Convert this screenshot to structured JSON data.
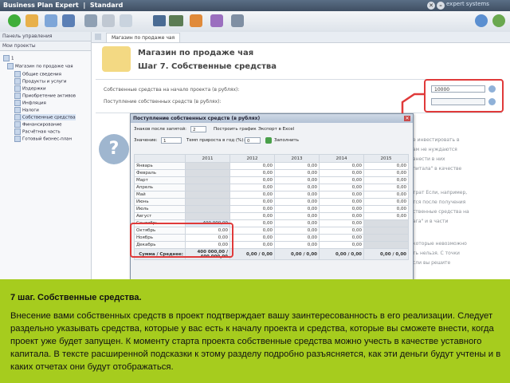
{
  "app": {
    "title": "Business Plan Expert",
    "edition": "Standard",
    "search_label": "expert systems"
  },
  "sidebar": {
    "panel_title": "Панель управления",
    "projects_title": "Мои проекты",
    "project_number": "1",
    "project_name": "Магазин по продаже чая",
    "items": [
      {
        "label": "Общие сведения"
      },
      {
        "label": "Продукты и услуги"
      },
      {
        "label": "Издержки"
      },
      {
        "label": "Приобретение активов"
      },
      {
        "label": "Инфляция"
      },
      {
        "label": "Налоги"
      },
      {
        "label": "Собственные средства"
      },
      {
        "label": "Финансирование"
      },
      {
        "label": "Расчётная часть"
      },
      {
        "label": "Готовый бизнес-план"
      }
    ]
  },
  "main": {
    "tab_label": "Магазин по продаже чая",
    "project_title": "Магазин по продаже чая",
    "step_title": "Шаг 7. Собственные средства",
    "field1_label": "Собственные средства на начало проекта (в рублях):",
    "field1_value": "10000",
    "field2_label": "Поступление собственных средств (в рублях):",
    "field2_value": "",
    "help_lines": [
      "е инвестировать в",
      "ам не нуждаются",
      "внести в них",
      "питала\" в качестве",
      "",
      "трат Если, например,",
      "тся после получения",
      "ственные средства на",
      "ага\" и в части",
      "",
      "которые невозможно",
      "ть нельзя. С точки",
      "сли вы решите"
    ]
  },
  "dialog": {
    "title": "Поступление собственных средств (в рублях)",
    "decimals_label": "Знаков после запятой:",
    "decimals_value": "2",
    "chart_button": "Построить график",
    "export_button": "Экспорт в Excel",
    "value_label": "Значение:",
    "value_input": "1",
    "growth_label": "Темп прироста в год (%):",
    "growth_input": "0",
    "fill_button": "Заполнить",
    "years": [
      "2011",
      "2012",
      "2013",
      "2014",
      "2015"
    ],
    "rows": [
      {
        "month": "Январь",
        "cells": [
          "",
          "0,00",
          "0,00",
          "0,00",
          "0,00"
        ]
      },
      {
        "month": "Февраль",
        "cells": [
          "",
          "0,00",
          "0,00",
          "0,00",
          "0,00"
        ]
      },
      {
        "month": "Март",
        "cells": [
          "",
          "0,00",
          "0,00",
          "0,00",
          "0,00"
        ]
      },
      {
        "month": "Апрель",
        "cells": [
          "",
          "0,00",
          "0,00",
          "0,00",
          "0,00"
        ]
      },
      {
        "month": "Май",
        "cells": [
          "",
          "0,00",
          "0,00",
          "0,00",
          "0,00"
        ]
      },
      {
        "month": "Июнь",
        "cells": [
          "",
          "0,00",
          "0,00",
          "0,00",
          "0,00"
        ]
      },
      {
        "month": "Июль",
        "cells": [
          "",
          "0,00",
          "0,00",
          "0,00",
          "0,00"
        ]
      },
      {
        "month": "Август",
        "cells": [
          "",
          "0,00",
          "0,00",
          "0,00",
          "0,00"
        ]
      },
      {
        "month": "Сентябрь",
        "cells": [
          "400 000,00",
          "0,00",
          "0,00",
          "0,00",
          ""
        ]
      },
      {
        "month": "Октябрь",
        "cells": [
          "0,00",
          "0,00",
          "0,00",
          "0,00",
          ""
        ]
      },
      {
        "month": "Ноябрь",
        "cells": [
          "0,00",
          "0,00",
          "0,00",
          "0,00",
          ""
        ]
      },
      {
        "month": "Декабрь",
        "cells": [
          "0,00",
          "0,00",
          "0,00",
          "0,00",
          ""
        ]
      }
    ],
    "sum_label": "Сумма / Среднее:",
    "sums": [
      "400 000,00 / 400 000,00",
      "0,00 / 0,00",
      "0,00 / 0,00",
      "0,00 / 0,00",
      "0,00 / 0,00"
    ]
  },
  "overlay": {
    "heading": "7 шаг. Собственные средства.",
    "body": "Внесение вами собственных средств в проект подтверждает вашу заинтересованность в его реализации. Следует раздельно указывать средства, которые у вас есть к началу проекта и средства, которые вы сможете внести, когда проект уже будет запущен. К моменту старта проекта собственные средства можно учесть в качестве уставного капитала. В тексте расширенной подсказки к этому разделу подробно разъясняется, как эти деньги будут учтены и в каких отчетах они будут отображаться."
  },
  "colors": {
    "accent_red": "#e03a3a",
    "overlay_green": "#a6cc1e",
    "titlebar": "#4a5b70"
  }
}
